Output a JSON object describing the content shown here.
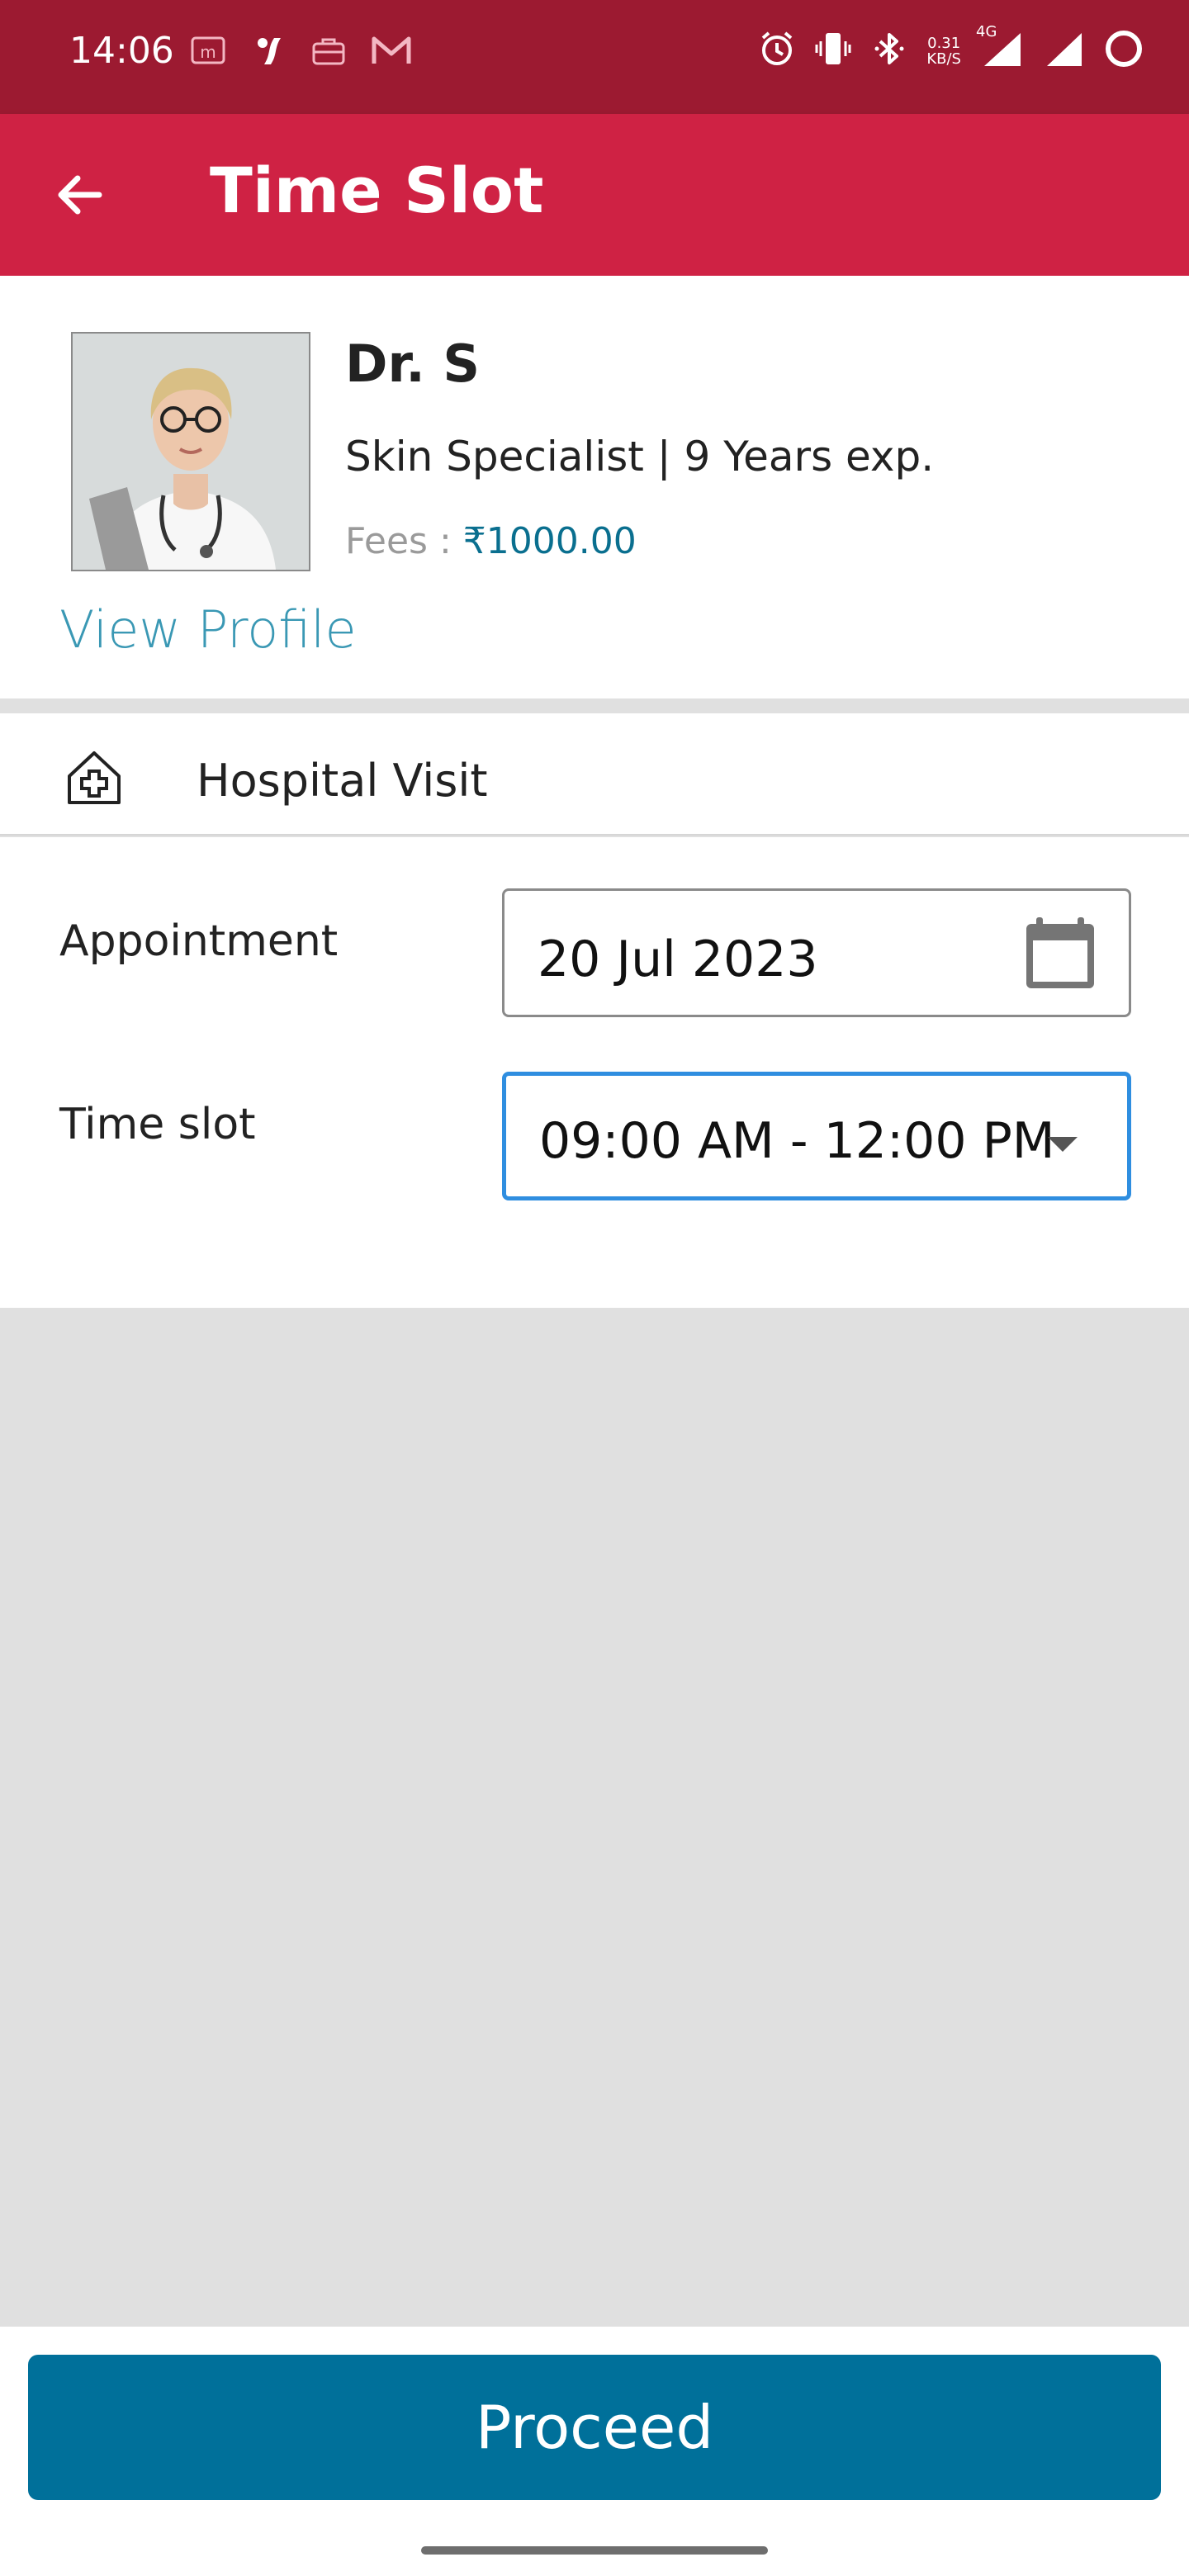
{
  "status_bar": {
    "time": "14:06",
    "network_speed_value": "0.31",
    "network_speed_unit": "KB/S",
    "network_type": "4G",
    "icons": [
      "m-icon",
      "stylized-app-icon",
      "briefcase-icon",
      "gmail-icon",
      "alarm-icon",
      "vibrate-icon",
      "bluetooth-icon",
      "signal-icon",
      "signal-icon",
      "battery-ring-icon"
    ]
  },
  "app_bar": {
    "title": "Time Slot",
    "back_icon": "arrow-left-icon"
  },
  "doctor": {
    "name": "Dr. S",
    "specialty": "Skin Specialist | 9 Years exp.",
    "fees_label": "Fees :",
    "fees_value": "₹1000.00",
    "view_profile": "View Profile"
  },
  "visit": {
    "icon": "hospital-icon",
    "label": "Hospital Visit"
  },
  "form": {
    "appointment_label": "Appointment",
    "appointment_date": "20 Jul 2023",
    "time_slot_label": "Time slot",
    "time_slot_value": "09:00 AM - 12:00 PM"
  },
  "actions": {
    "proceed_label": "Proceed"
  },
  "colors": {
    "status_bar": "#9c1a31",
    "app_bar": "#cf2244",
    "accent_link": "#3a98b4",
    "fees_value": "#0a6f8f",
    "primary_button": "#00709a",
    "focus_border": "#2f8ee0",
    "background": "#e0e0e0"
  }
}
